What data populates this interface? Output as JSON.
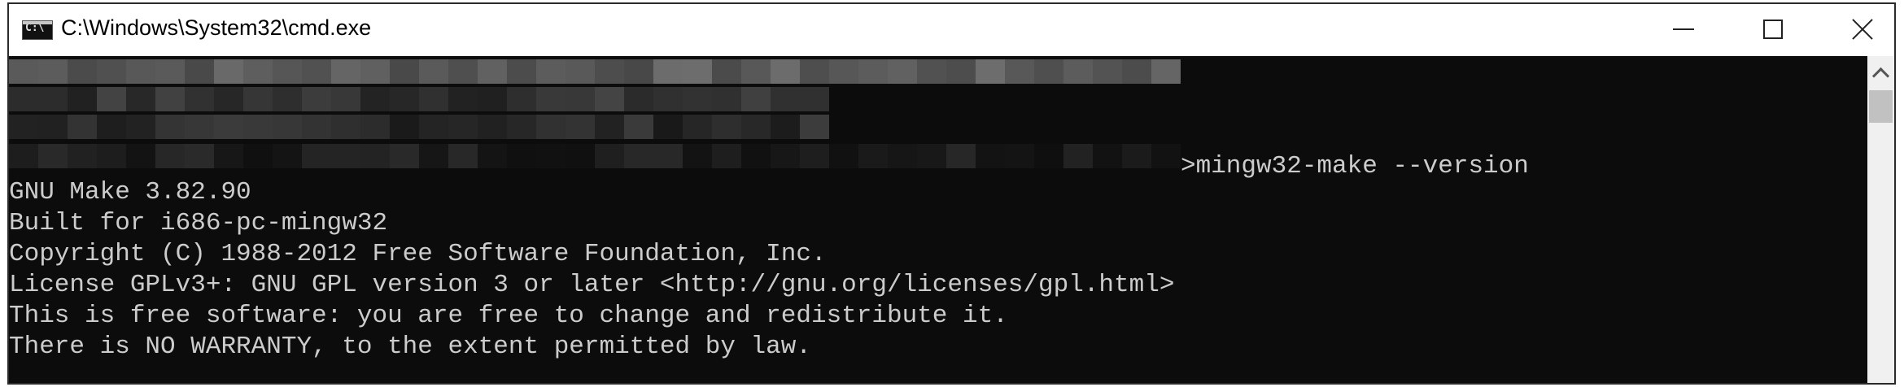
{
  "window": {
    "title": "C:\\Windows\\System32\\cmd.exe",
    "icon": "cmd-console-icon"
  },
  "controls": {
    "minimize_icon": "minimize-icon",
    "maximize_icon": "maximize-icon",
    "close_icon": "close-icon"
  },
  "console": {
    "command": ">mingw32-make --version",
    "output": [
      "GNU Make 3.82.90",
      "Built for i686-pc-mingw32",
      "Copyright (C) 1988-2012 Free Software Foundation, Inc.",
      "License GPLv3+: GNU GPL version 3 or later <http://gnu.org/licenses/gpl.html>",
      "This is free software: you are free to change and redistribute it.",
      "There is NO WARRANTY, to the extent permitted by law."
    ],
    "background": "#0c0c0c",
    "foreground": "#cccccc"
  },
  "scrollbar": {
    "up_icon": "scroll-up-arrow-icon"
  }
}
